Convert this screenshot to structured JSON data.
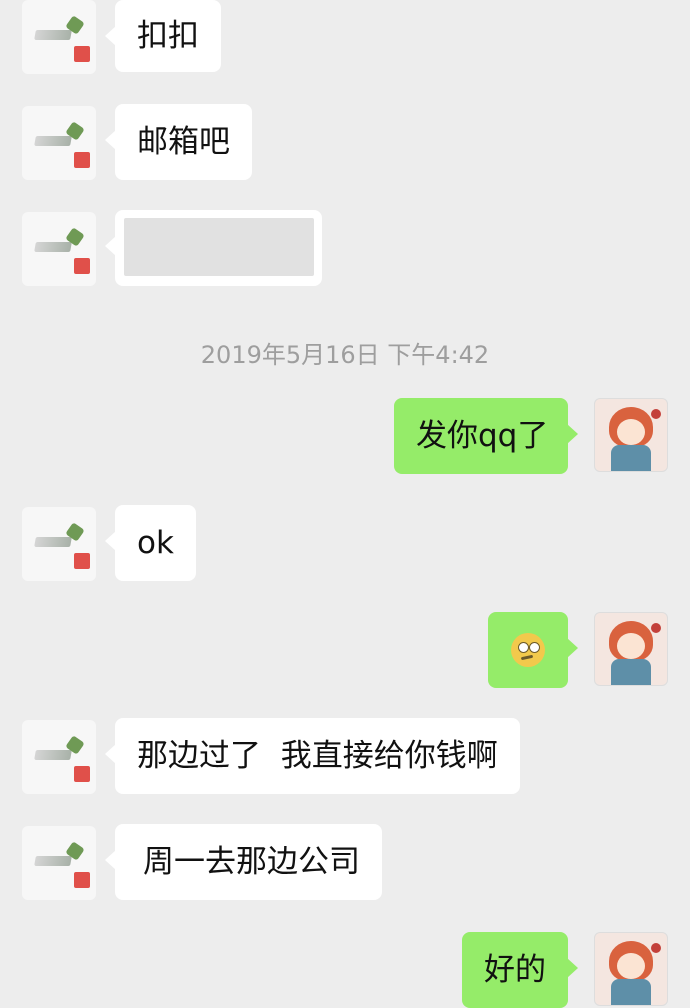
{
  "timestamp": "2019年5月16日 下午4:42",
  "messages": [
    {
      "side": "left",
      "text": "扣扣"
    },
    {
      "side": "left",
      "text": "邮箱吧"
    },
    {
      "side": "left",
      "text": ""
    },
    {
      "side": "right",
      "text": "发你qq了"
    },
    {
      "side": "left",
      "text": "ok"
    },
    {
      "side": "right",
      "text": "",
      "emoji": "confused-face-emoji"
    },
    {
      "side": "left",
      "text": "那边过了  我直接给你钱啊"
    },
    {
      "side": "left",
      "text": "周一去那边公司"
    },
    {
      "side": "right",
      "text": "好的"
    }
  ]
}
